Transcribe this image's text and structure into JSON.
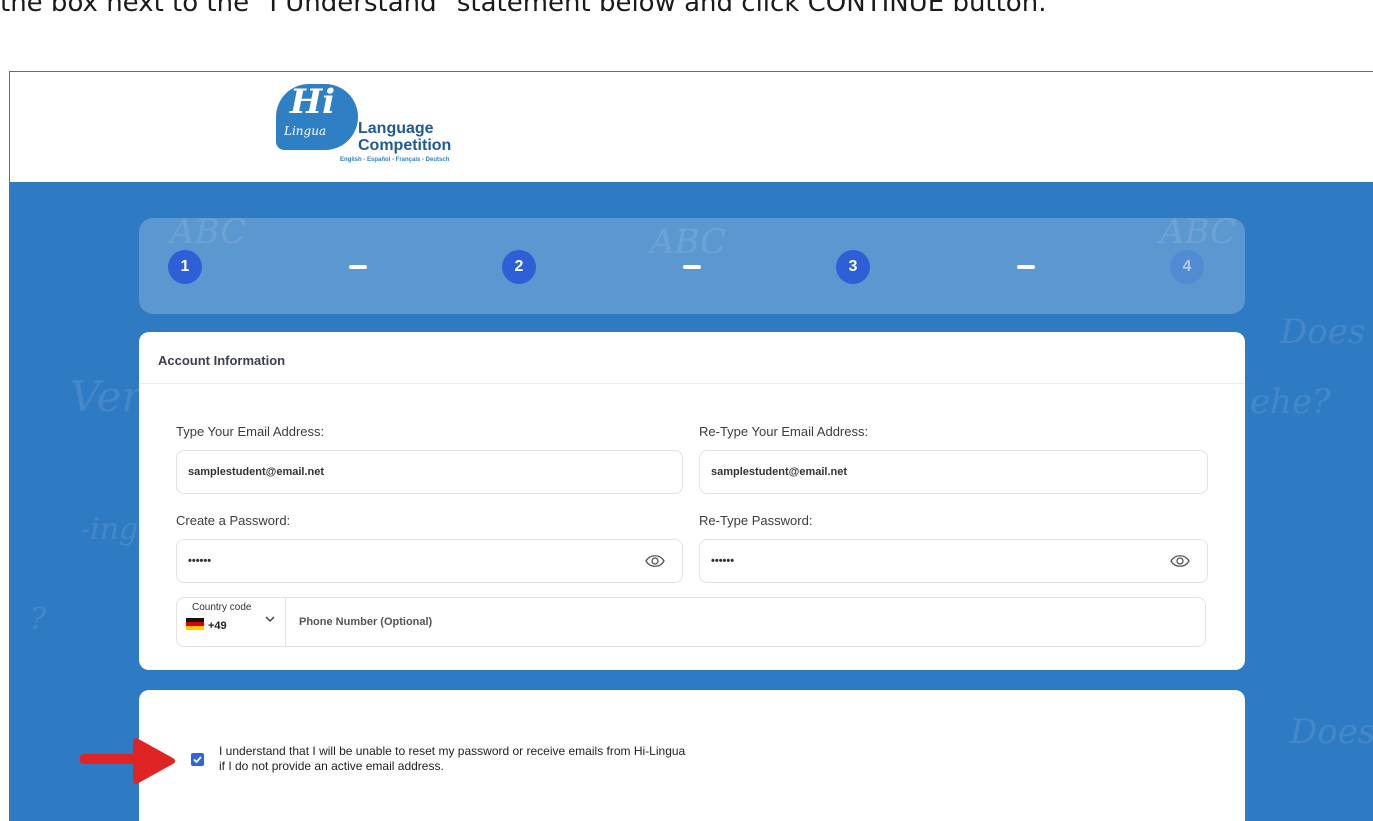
{
  "instruction": {
    "text": "the box next to the \"I Understand\" statement below and click CONTINUE button."
  },
  "logo": {
    "hi": "Hi",
    "lingua": "Lingua",
    "line1": "Language",
    "line2": "Competition",
    "languages": "English - Español - Français - Deutsch"
  },
  "stepper": {
    "steps": [
      {
        "label": "1",
        "active": true
      },
      {
        "label": "2",
        "active": true
      },
      {
        "label": "3",
        "active": true
      },
      {
        "label": "4",
        "active": false
      }
    ]
  },
  "account": {
    "title": "Account Information",
    "email_label": "Type Your Email Address:",
    "email_value": "samplestudent@email.net",
    "retype_email_label": "Re-Type Your Email Address:",
    "retype_email_value": "samplestudent@email.net",
    "password_label": "Create a Password:",
    "password_value": "••••••",
    "retype_password_label": "Re-Type Password:",
    "retype_password_value": "••••••",
    "country_code_label": "Country code",
    "country_code_value": "+49",
    "phone_placeholder": "Phone Number (Optional)",
    "password_icon": "eye-icon"
  },
  "consent": {
    "checked": true,
    "line1": "I understand that I will be unable to reset my password or receive emails from Hi-Lingua",
    "line2": "if I do not provide an active email address."
  },
  "colors": {
    "brand_blue": "#2f7bc3",
    "step_blue": "#2f5fd6",
    "arrow_red": "#e02424"
  }
}
